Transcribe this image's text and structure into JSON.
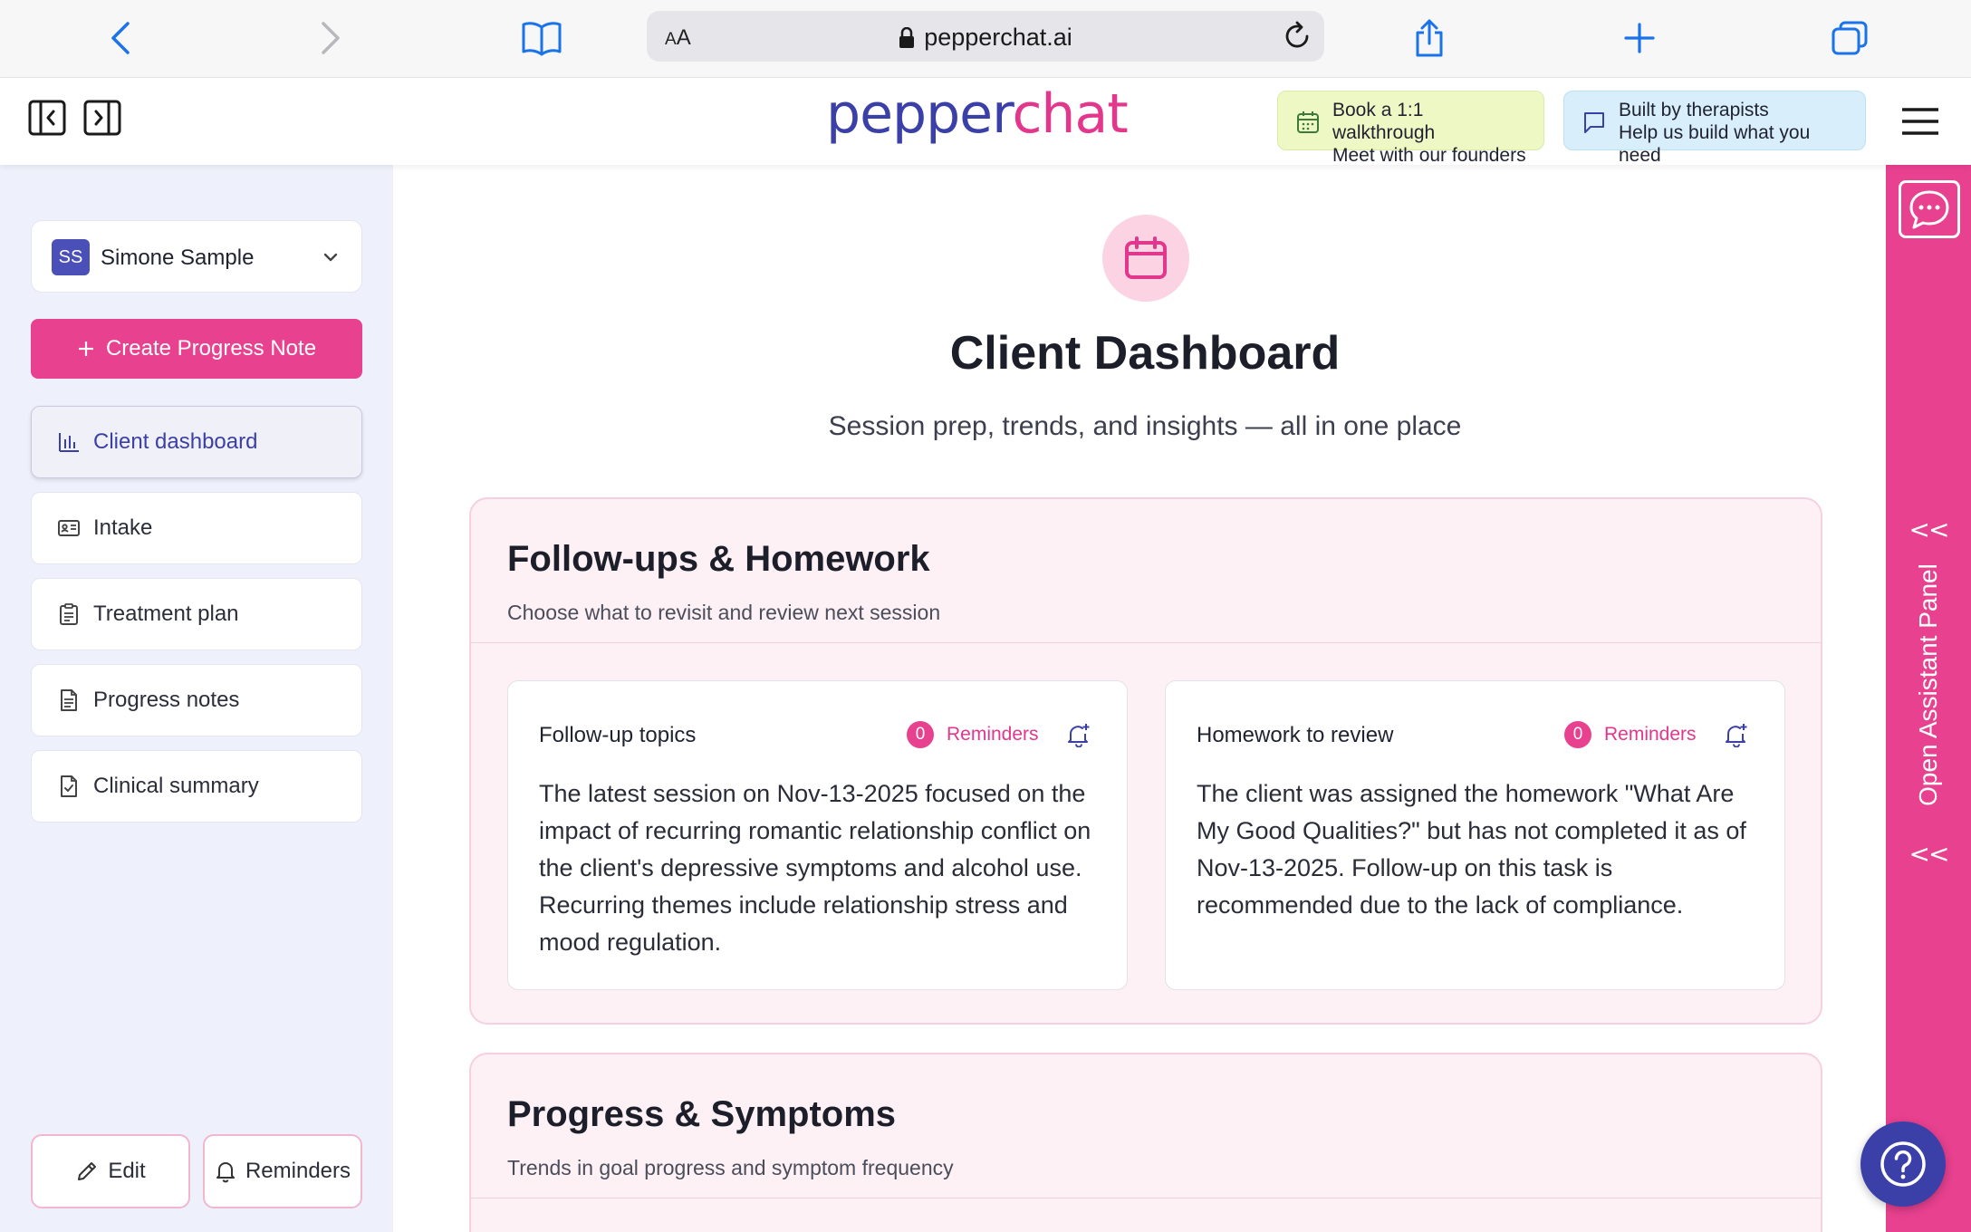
{
  "browser": {
    "url_aa_big": "A",
    "url_aa_small": "A",
    "url": "pepperchat.ai"
  },
  "header": {
    "logo_part1": "pepper",
    "logo_part2": "chat",
    "promo_book": {
      "line1": "Book a 1:1 walkthrough",
      "line2": "Meet with our founders"
    },
    "promo_built": {
      "line1": "Built by therapists",
      "line2": "Help us build what you need"
    }
  },
  "sidebar": {
    "client_initials": "SS",
    "client_name": "Simone Sample",
    "create_label": "Create Progress Note",
    "items": [
      {
        "label": "Client dashboard",
        "icon": "bar-chart-icon",
        "active": true
      },
      {
        "label": "Intake",
        "icon": "id-card-icon",
        "active": false
      },
      {
        "label": "Treatment plan",
        "icon": "clipboard-icon",
        "active": false
      },
      {
        "label": "Progress notes",
        "icon": "document-icon",
        "active": false
      },
      {
        "label": "Clinical summary",
        "icon": "file-check-icon",
        "active": false
      }
    ],
    "edit_label": "Edit",
    "reminders_label": "Reminders"
  },
  "main": {
    "title": "Client Dashboard",
    "subtitle": "Session prep, trends, and insights — all in one place",
    "followups": {
      "title": "Follow-ups & Homework",
      "subtitle": "Choose what to revisit and review next session",
      "cards": [
        {
          "title": "Follow-up topics",
          "reminder_count": "0",
          "reminder_label": "Reminders",
          "text": "The latest session on Nov-13-2025 focused on the impact of recurring romantic relationship conflict on the client's depressive symptoms and alcohol use. Recurring themes include relationship stress and mood regulation."
        },
        {
          "title": "Homework to review",
          "reminder_count": "0",
          "reminder_label": "Reminders",
          "text": "The client was assigned the homework \"What Are My Good Qualities?\" but has not completed it as of Nov-13-2025. Follow-up on this task is recommended due to the lack of compliance."
        }
      ]
    },
    "progress": {
      "title": "Progress & Symptoms",
      "subtitle": "Trends in goal progress and symptom frequency"
    }
  },
  "assistant": {
    "arrows_top": "<<",
    "label": "Open Assistant Panel",
    "arrows_bottom": "<<"
  },
  "colors": {
    "brand_blue": "#3b3fa8",
    "brand_pink": "#e2378c",
    "sidebar_bg": "#eef0fb",
    "section_bg": "#fef1f6"
  }
}
